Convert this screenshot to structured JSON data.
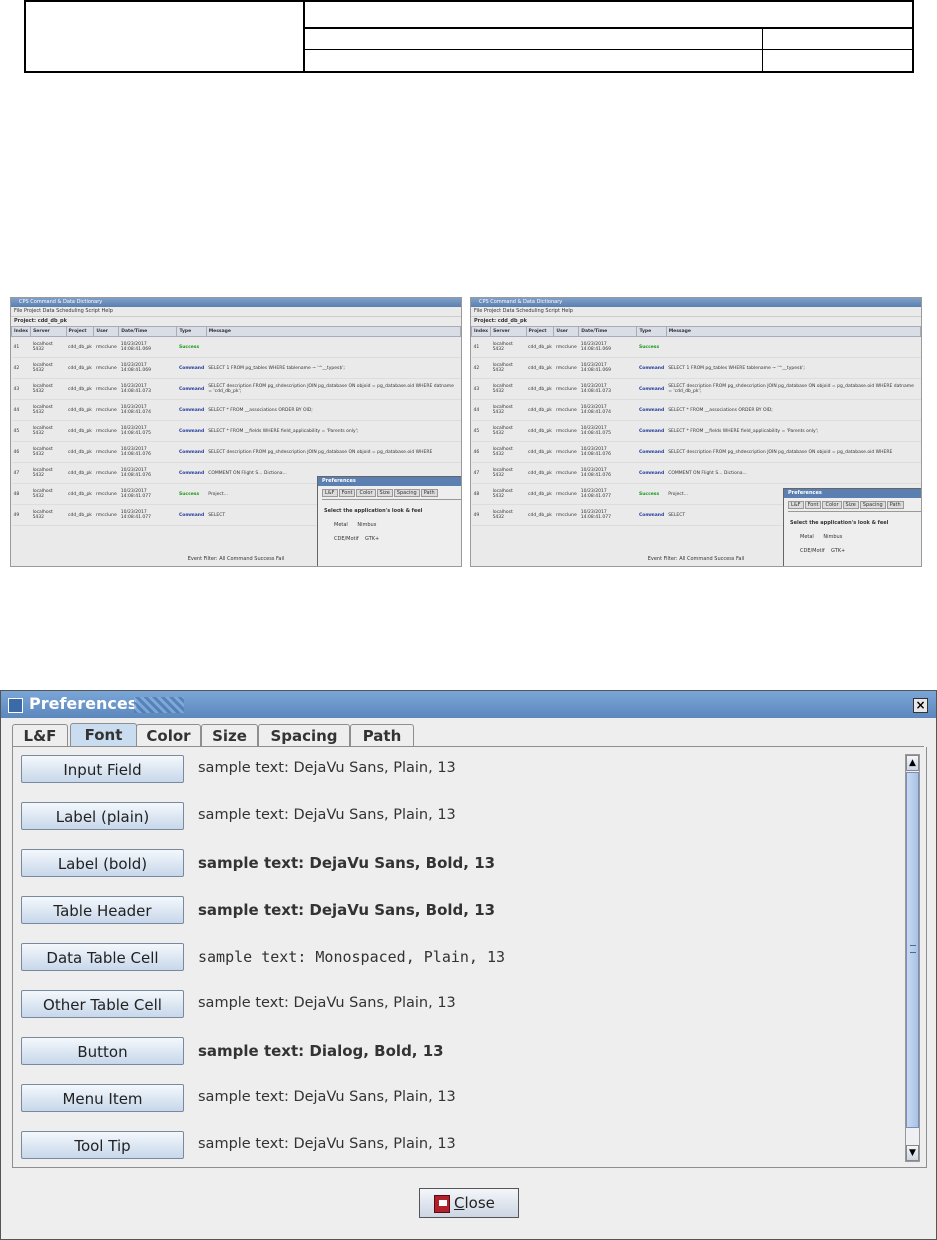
{
  "window": {
    "title": "Preferences",
    "tabs": [
      "L&F",
      "Font",
      "Color",
      "Size",
      "Spacing",
      "Path"
    ],
    "active_tab": "Font",
    "close_button": {
      "mnemonic": "C",
      "rest": "lose"
    }
  },
  "font_rows": [
    {
      "button": "Input Field",
      "sample": "sample text: DejaVu Sans, Plain, 13",
      "style": "plain"
    },
    {
      "button": "Label (plain)",
      "sample": "sample text: DejaVu Sans, Plain, 13",
      "style": "plain"
    },
    {
      "button": "Label (bold)",
      "sample": "sample text: DejaVu Sans, Bold, 13",
      "style": "bold"
    },
    {
      "button": "Table Header",
      "sample": "sample text: DejaVu Sans, Bold, 13",
      "style": "bold"
    },
    {
      "button": "Data Table Cell",
      "sample": "sample text: Monospaced, Plain, 13",
      "style": "mono"
    },
    {
      "button": "Other Table Cell",
      "sample": "sample text: DejaVu Sans, Plain, 13",
      "style": "plain"
    },
    {
      "button": "Button",
      "sample": "sample text: Dialog, Bold, 13",
      "style": "bold"
    },
    {
      "button": "Menu Item",
      "sample": "sample text: DejaVu Sans, Plain, 13",
      "style": "plain"
    },
    {
      "button": "Tool Tip",
      "sample": "sample text: DejaVu Sans, Plain, 13",
      "style": "plain"
    }
  ],
  "thumbnails": {
    "app_title": "CPS Command & Data Dictionary",
    "menu": "File  Project  Data  Scheduling  Script  Help",
    "project": "Project: cdd_db_pk",
    "columns": [
      "Index",
      "Server",
      "Project",
      "User",
      "Date/Time",
      "Type",
      "Message"
    ],
    "rows": [
      [
        "41",
        "localhost 5432",
        "cdd_db_pk",
        "rmcclune",
        "10/23/2017 14:08:41.069",
        "Success",
        ""
      ],
      [
        "42",
        "localhost 5432",
        "cdd_db_pk",
        "rmcclune",
        "10/23/2017 14:08:41.069",
        "Command",
        "SELECT 1 FROM pg_tables WHERE tablename ~ '^__types$';"
      ],
      [
        "43",
        "localhost 5432",
        "cdd_db_pk",
        "rmcclune",
        "10/23/2017 14:08:41.073",
        "Command",
        "SELECT description FROM pg_shdescription JOIN pg_database ON objoid = pg_database.oid WHERE datname = 'cdd_db_pk';"
      ],
      [
        "44",
        "localhost 5432",
        "cdd_db_pk",
        "rmcclune",
        "10/23/2017 14:08:41.074",
        "Command",
        "SELECT * FROM __associations ORDER BY OID;"
      ],
      [
        "45",
        "localhost 5432",
        "cdd_db_pk",
        "rmcclune",
        "10/23/2017 14:08:41.075",
        "Command",
        "SELECT * FROM __fields WHERE field_applicability = 'Parents only';"
      ],
      [
        "46",
        "localhost 5432",
        "cdd_db_pk",
        "rmcclune",
        "10/23/2017 14:08:41.076",
        "Command",
        "SELECT description FROM pg_shdescription JOIN pg_database ON objoid = pg_database.oid WHERE"
      ],
      [
        "47",
        "localhost 5432",
        "cdd_db_pk",
        "rmcclune",
        "10/23/2017 14:08:41.076",
        "Command",
        "COMMENT ON Flight S... Dictiona..."
      ],
      [
        "48",
        "localhost 5432",
        "cdd_db_pk",
        "rmcclune",
        "10/23/2017 14:08:41.077",
        "Success",
        "Project..."
      ],
      [
        "49",
        "localhost 5432",
        "cdd_db_pk",
        "rmcclune",
        "10/23/2017 14:08:41.077",
        "Command",
        "SELECT"
      ]
    ],
    "filter": "Event Filter:  All  Command  Success  Fail",
    "mini_pref": {
      "title": "Preferences",
      "tabs": [
        "L&F",
        "Font",
        "Color",
        "Size",
        "Spacing",
        "Path"
      ],
      "question": "Select the application's look & feel",
      "options": [
        "Metal",
        "Nimbus",
        "CDE/Motif",
        "GTK+"
      ]
    }
  }
}
